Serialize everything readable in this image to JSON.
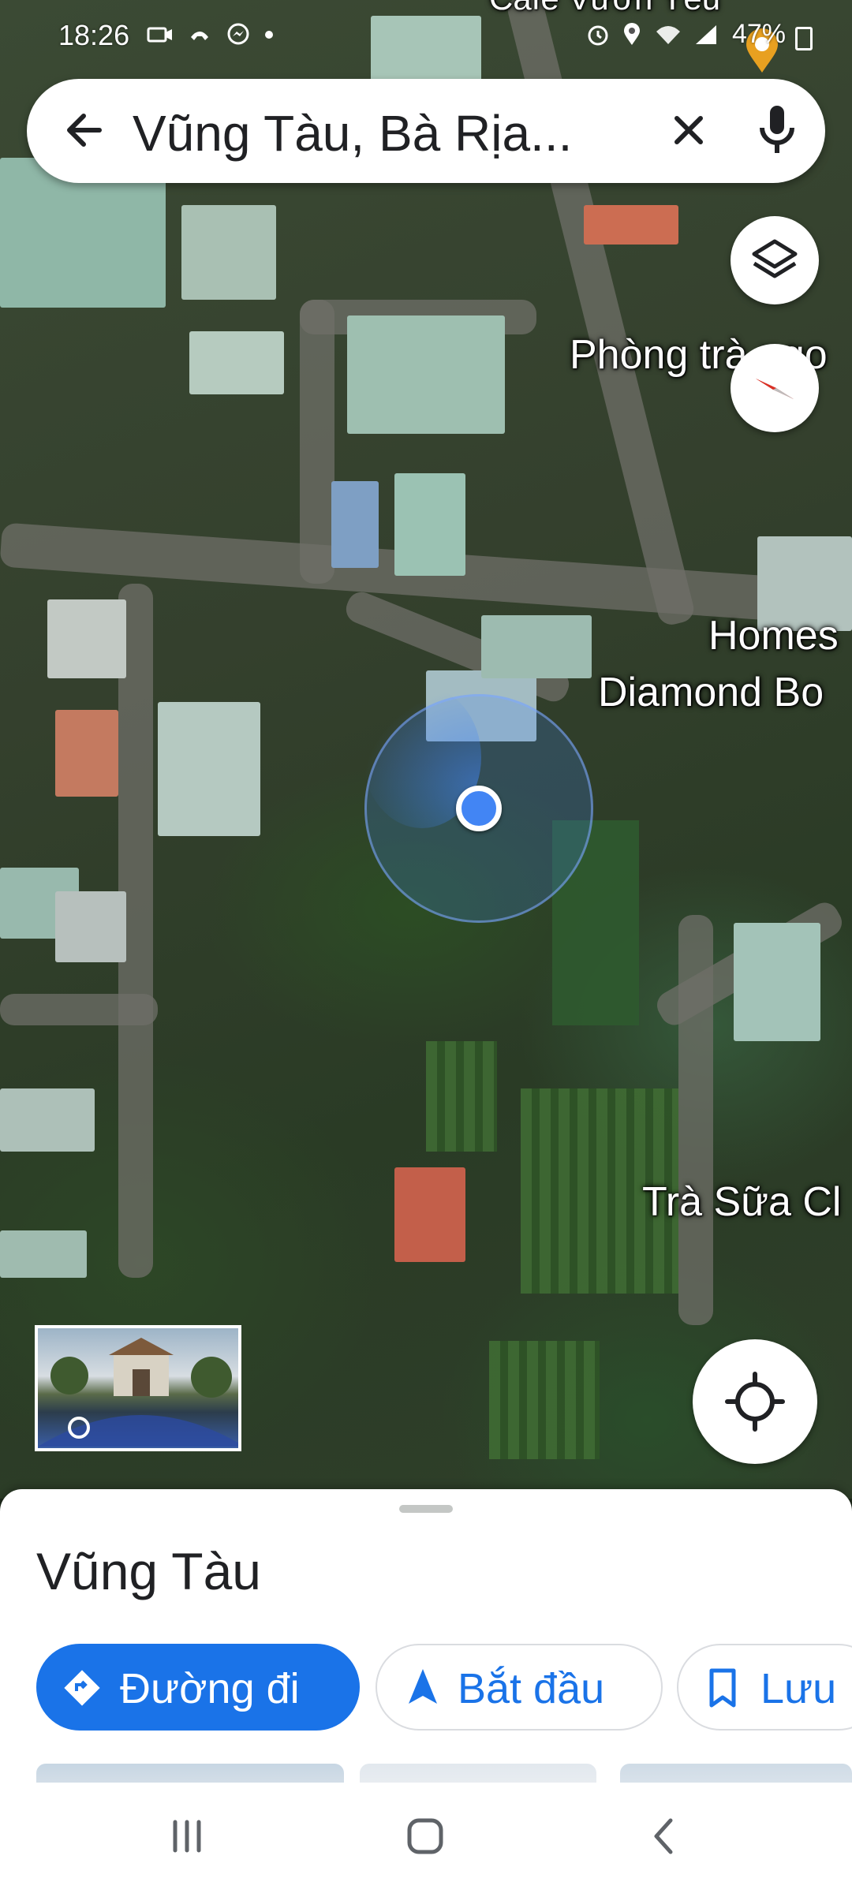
{
  "status_bar": {
    "time": "18:26",
    "left_icons": [
      "video-icon",
      "call-icon",
      "messenger-icon",
      "dot-icon"
    ],
    "right_icons": [
      "alarm-icon",
      "location-icon",
      "wifi-icon",
      "signal-icon"
    ],
    "battery": "47%"
  },
  "search": {
    "query": "Vũng Tàu, Bà Rịa..."
  },
  "map": {
    "labels": {
      "top_partial": "Café Vườn Yêu",
      "poi_1": "Phòng trà ngo",
      "poi_2_line1": "Homes",
      "poi_2_line2": "Diamond Bo",
      "poi_3": "Trà Sữa Cl"
    },
    "controls": [
      "layers-icon",
      "compass-icon",
      "my-location-icon"
    ]
  },
  "sheet": {
    "place_name": "Vũng Tàu",
    "actions": {
      "directions": "Đường đi",
      "start": "Bắt đầu",
      "save": "Lưu"
    }
  },
  "colors": {
    "accent": "#1a73e8",
    "location_dot": "#4285f4"
  }
}
